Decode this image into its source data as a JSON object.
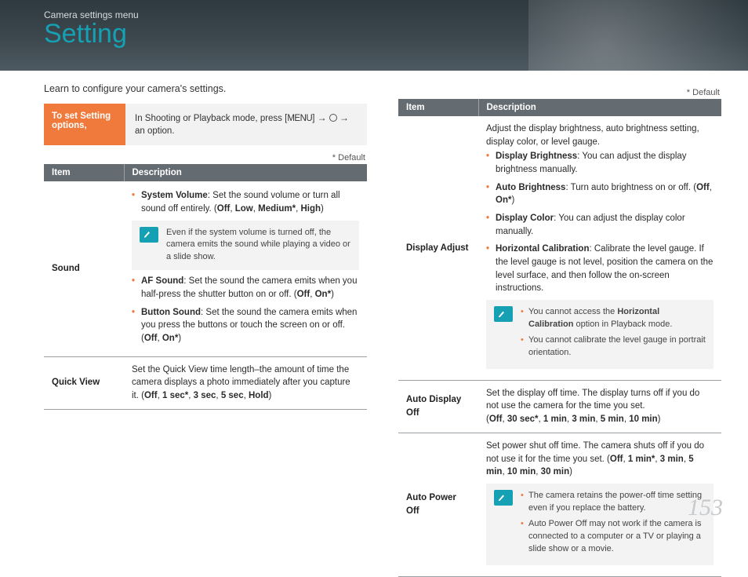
{
  "header": {
    "breadcrumb": "Camera settings menu",
    "title": "Setting"
  },
  "intro": "Learn to configure your camera's settings.",
  "setRow": {
    "label": "To set Setting options,",
    "pre": "In Shooting or Playback mode, press [",
    "menu": "MENU",
    "mid1": "] ",
    "mid2": " ",
    "post": " an option."
  },
  "defaultNote": "* Default",
  "arrow": "→",
  "table": {
    "h0": "Item",
    "h1": "Description"
  },
  "left": {
    "row0": {
      "label": "Sound",
      "b1_pre": "System Volume",
      "b1_post": ": Set the sound volume or turn all sound off entirely. (",
      "b1_opts": [
        "Off",
        "Low",
        "Medium*",
        "High"
      ],
      "note": "Even if the system volume is turned off, the camera emits the sound while playing a video or a slide show.",
      "b2_pre": "AF Sound",
      "b2_post": ": Set the sound the camera emits when you half-press the shutter button on or off. (",
      "b2_opts": [
        "Off",
        "On*"
      ],
      "b3_pre": "Button Sound",
      "b3_post": ": Set the sound the camera emits when you press the buttons or touch the screen on or off. (",
      "b3_opts": [
        "Off",
        "On*"
      ]
    },
    "row1": {
      "label": "Quick View",
      "text": "Set the Quick View time length–the amount of time the camera displays a photo immediately after you capture it. (",
      "opts": [
        "Off",
        "1 sec*",
        "3 sec",
        "5 sec",
        "Hold"
      ]
    }
  },
  "right": {
    "row0": {
      "label": "Display Adjust",
      "intro": "Adjust the display brightness, auto brightness setting, display color, or level gauge.",
      "b1_pre": "Display Brightness",
      "b1_post": ": You can adjust the display brightness manually.",
      "b2_pre": "Auto Brightness",
      "b2_post": ": Turn auto brightness on or off. (",
      "b2_opts": [
        "Off",
        "On*"
      ],
      "b3_pre": "Display Color",
      "b3_post": ": You can adjust the display color manually.",
      "b4_pre": "Horizontal Calibration",
      "b4_post": ": Calibrate the level gauge. If the level gauge is not level, position the camera on the level surface, and then follow the on-screen instructions.",
      "note_l1a": "You cannot access the ",
      "note_l1b": "Horizontal Calibration",
      "note_l1c": " option in Playback mode.",
      "note_l2": "You cannot calibrate the level gauge in portrait orientation."
    },
    "row1": {
      "label": "Auto Display Off",
      "text": "Set the display off time. The display turns off if you do not use the camera for the time you set.",
      "opts": [
        "Off",
        "30 sec*",
        "1 min",
        "3 min",
        "5 min",
        "10 min"
      ]
    },
    "row2": {
      "label": "Auto Power Off",
      "text": "Set power shut off time. The camera shuts off if you do not use it for the time you set. (",
      "opts": [
        "Off",
        "1 min*",
        "3 min",
        "5 min",
        "10 min",
        "30 min"
      ],
      "note_l1": "The camera retains the power-off time setting even if you replace the battery.",
      "note_l2": "Auto Power Off may not work if the camera is connected to a computer or a TV or playing a slide show or a movie."
    }
  },
  "pageNumber": "153"
}
